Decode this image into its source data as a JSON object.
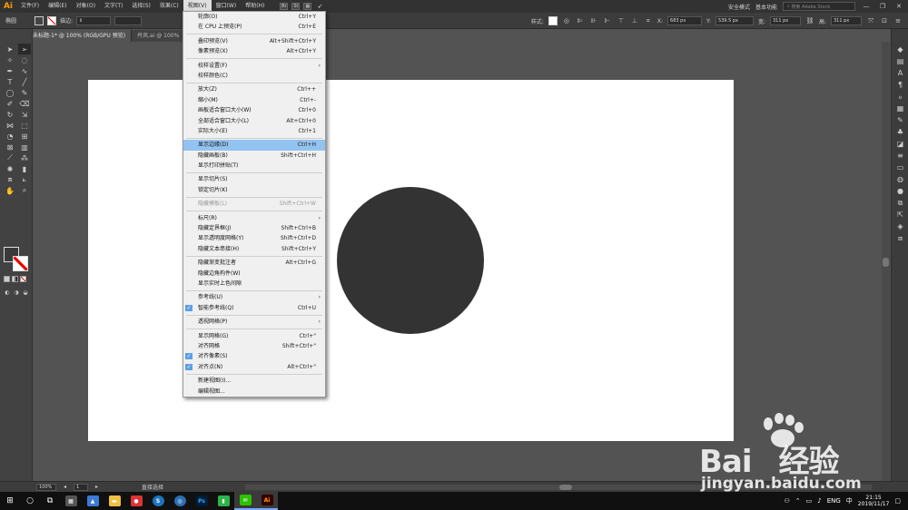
{
  "app": {
    "logo": "Ai"
  },
  "menubar": {
    "items": [
      "文件(F)",
      "编辑(E)",
      "对象(O)",
      "文字(T)",
      "选择(S)",
      "效果(C)",
      "视图(V)",
      "窗口(W)",
      "帮助(H)"
    ],
    "active_index": 6,
    "safe_mode": "安全模式",
    "workspace": "基本功能",
    "search_placeholder": "搜索 Adobe Stock"
  },
  "controlbar": {
    "label": "椭圆",
    "stroke_label": "描边:",
    "style_label": "样式:",
    "x_label": "X:",
    "x_value": "683 px",
    "y_label": "Y:",
    "y_value": "539.5 px",
    "w_label": "宽:",
    "w_value": "311 px",
    "h_label": "高:",
    "h_value": "311 px"
  },
  "tabs": [
    {
      "label": "未标题-1* @ 100% (RGB/GPU 预览)",
      "active": true
    },
    {
      "label": "丹凤.ai @ 100%",
      "active": false
    }
  ],
  "view_menu": {
    "items": [
      {
        "label": "轮廓(O)",
        "shortcut": "Ctrl+Y"
      },
      {
        "label": "在 CPU 上预览(P)",
        "shortcut": "Ctrl+E"
      },
      {
        "sep": true
      },
      {
        "label": "叠印预览(V)",
        "shortcut": "Alt+Shift+Ctrl+Y"
      },
      {
        "label": "像素预览(X)",
        "shortcut": "Alt+Ctrl+Y"
      },
      {
        "sep": true
      },
      {
        "label": "校样设置(F)",
        "shortcut": "",
        "submenu": true
      },
      {
        "label": "校样颜色(C)",
        "shortcut": ""
      },
      {
        "sep": true
      },
      {
        "label": "放大(Z)",
        "shortcut": "Ctrl++"
      },
      {
        "label": "缩小(M)",
        "shortcut": "Ctrl+-"
      },
      {
        "label": "画板适合窗口大小(W)",
        "shortcut": "Ctrl+0"
      },
      {
        "label": "全部适合窗口大小(L)",
        "shortcut": "Alt+Ctrl+0"
      },
      {
        "label": "实际大小(E)",
        "shortcut": "Ctrl+1"
      },
      {
        "sep": true
      },
      {
        "label": "显示边缘(D)",
        "shortcut": "Ctrl+H",
        "highlight": true
      },
      {
        "label": "隐藏画板(B)",
        "shortcut": "Shift+Ctrl+H"
      },
      {
        "label": "显示打印拼贴(T)",
        "shortcut": ""
      },
      {
        "sep": true
      },
      {
        "label": "显示切片(S)",
        "shortcut": ""
      },
      {
        "label": "锁定切片(K)",
        "shortcut": ""
      },
      {
        "sep": true
      },
      {
        "label": "隐藏模板(L)",
        "shortcut": "Shift+Ctrl+W",
        "disabled": true
      },
      {
        "sep": true
      },
      {
        "label": "标尺(R)",
        "shortcut": "",
        "submenu": true
      },
      {
        "label": "隐藏定界框(J)",
        "shortcut": "Shift+Ctrl+B"
      },
      {
        "label": "显示透明度网格(Y)",
        "shortcut": "Shift+Ctrl+D"
      },
      {
        "label": "隐藏文本串接(H)",
        "shortcut": "Shift+Ctrl+Y"
      },
      {
        "sep": true
      },
      {
        "label": "隐藏渐变批注者",
        "shortcut": "Alt+Ctrl+G"
      },
      {
        "label": "隐藏边角构件(W)",
        "shortcut": ""
      },
      {
        "label": "显示实时上色间隙",
        "shortcut": ""
      },
      {
        "sep": true
      },
      {
        "label": "参考线(U)",
        "shortcut": "",
        "submenu": true
      },
      {
        "label": "智能参考线(Q)",
        "shortcut": "Ctrl+U",
        "checked": true
      },
      {
        "sep": true
      },
      {
        "label": "透视网格(P)",
        "shortcut": "",
        "submenu": true
      },
      {
        "sep": true
      },
      {
        "label": "显示网格(G)",
        "shortcut": "Ctrl+\""
      },
      {
        "label": "对齐网格",
        "shortcut": "Shift+Ctrl+\""
      },
      {
        "label": "对齐像素(S)",
        "shortcut": "",
        "checked": true
      },
      {
        "label": "对齐点(N)",
        "shortcut": "Alt+Ctrl+\"",
        "checked": true
      },
      {
        "sep": true
      },
      {
        "label": "新建视图(I)...",
        "shortcut": ""
      },
      {
        "label": "编辑视图...",
        "shortcut": ""
      }
    ]
  },
  "statusbar": {
    "zoom": "100%",
    "page": "1",
    "tool": "直接选择"
  },
  "taskbar": {
    "ime": "ENG",
    "ime_char": "中",
    "time": "21:15",
    "date": "2019/11/17"
  },
  "watermark": {
    "brand": "Bai",
    "brand_cn": "经验",
    "url": "jingyan.baidu.com"
  },
  "colors": {
    "accent_highlight": "#93c3f0",
    "circle": "#333333",
    "ai_orange": "#ff9a00"
  }
}
